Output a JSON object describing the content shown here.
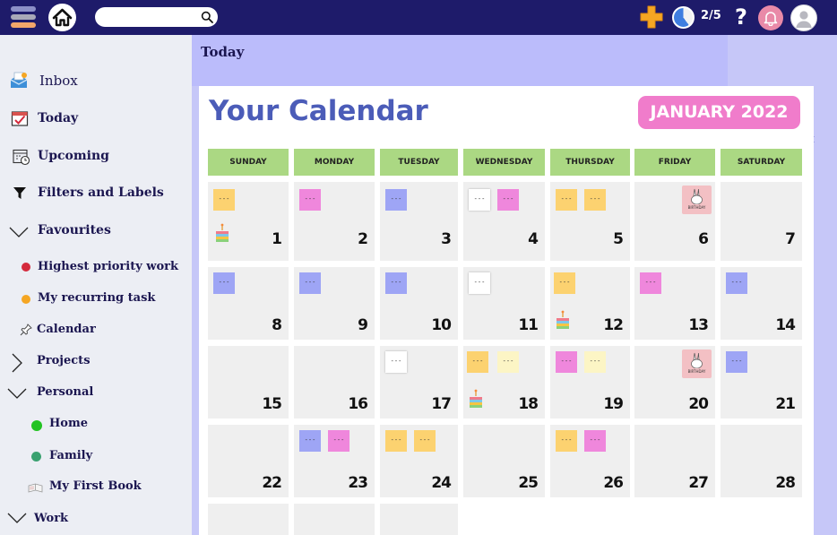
{
  "topbar": {
    "search": {
      "value": "",
      "placeholder": ""
    },
    "progress": {
      "text": "2/5",
      "completed_fraction": 0.4
    },
    "help_label": "?",
    "colors": {
      "bar": "#1e1b6a",
      "add": "#f5a623",
      "bell": "#e98aa8"
    }
  },
  "sidebar": {
    "inbox": "Inbox",
    "today": "Today",
    "upcoming": "Upcoming",
    "filters": "Filters and Labels",
    "favourites": "Favourites",
    "fav_items": [
      {
        "label": "Highest priority work",
        "color": "#d42a3c"
      },
      {
        "label": "My recurring task",
        "color": "#f5a623"
      }
    ],
    "calendar": "Calendar",
    "projects": "Projects",
    "personal": "Personal",
    "home": {
      "label": "Home",
      "color": "#22c322"
    },
    "family": {
      "label": "Family",
      "color": "#3aa170"
    },
    "book": "My First Book",
    "work": "Work"
  },
  "main": {
    "header": "Today",
    "title": "Your Calendar",
    "month": "JANUARY 2022",
    "side_mark": "t",
    "weekdays": [
      "SUNDAY",
      "MONDAY",
      "TUESDAY",
      "WEDNESDAY",
      "THURSDAY",
      "FRIDAY",
      "SATURDAY"
    ],
    "note_text": "---",
    "birthday_text": "BIRTHDAY",
    "note_colors": {
      "yellow": "#fcd270",
      "pink": "#ef87dc",
      "blue": "#9ea5f5",
      "white": "#ffffff",
      "cream": "#fcf5c5"
    },
    "days": [
      {
        "n": "1",
        "notes": [
          "yellow"
        ],
        "cake": true
      },
      {
        "n": "2",
        "notes": [
          "pink"
        ]
      },
      {
        "n": "3",
        "notes": [
          "blue"
        ]
      },
      {
        "n": "4",
        "notes": [
          "white",
          "pink"
        ]
      },
      {
        "n": "5",
        "notes": [
          "yellow",
          "yellow"
        ]
      },
      {
        "n": "6",
        "notes": [],
        "birthday": true
      },
      {
        "n": "7",
        "notes": []
      },
      {
        "n": "8",
        "notes": [
          "blue"
        ]
      },
      {
        "n": "9",
        "notes": [
          "blue"
        ]
      },
      {
        "n": "10",
        "notes": [
          "blue"
        ]
      },
      {
        "n": "11",
        "notes": [
          "white"
        ]
      },
      {
        "n": "12",
        "notes": [
          "yellow"
        ],
        "cake": true
      },
      {
        "n": "13",
        "notes": [
          "pink"
        ]
      },
      {
        "n": "14",
        "notes": [
          "blue"
        ]
      },
      {
        "n": "15",
        "notes": []
      },
      {
        "n": "16",
        "notes": []
      },
      {
        "n": "17",
        "notes": [
          "white"
        ]
      },
      {
        "n": "18",
        "notes": [
          "yellow",
          "cream"
        ],
        "cake": true
      },
      {
        "n": "19",
        "notes": [
          "pink",
          "cream"
        ]
      },
      {
        "n": "20",
        "notes": [],
        "birthday": true
      },
      {
        "n": "21",
        "notes": [
          "blue"
        ]
      },
      {
        "n": "22",
        "notes": []
      },
      {
        "n": "23",
        "notes": [
          "blue",
          "pink"
        ]
      },
      {
        "n": "24",
        "notes": [
          "yellow",
          "yellow"
        ]
      },
      {
        "n": "25",
        "notes": []
      },
      {
        "n": "26",
        "notes": [
          "yellow",
          "pink"
        ]
      },
      {
        "n": "27",
        "notes": []
      },
      {
        "n": "28",
        "notes": []
      },
      {
        "n": "",
        "notes": []
      },
      {
        "n": "",
        "notes": []
      },
      {
        "n": "",
        "notes": []
      }
    ]
  }
}
